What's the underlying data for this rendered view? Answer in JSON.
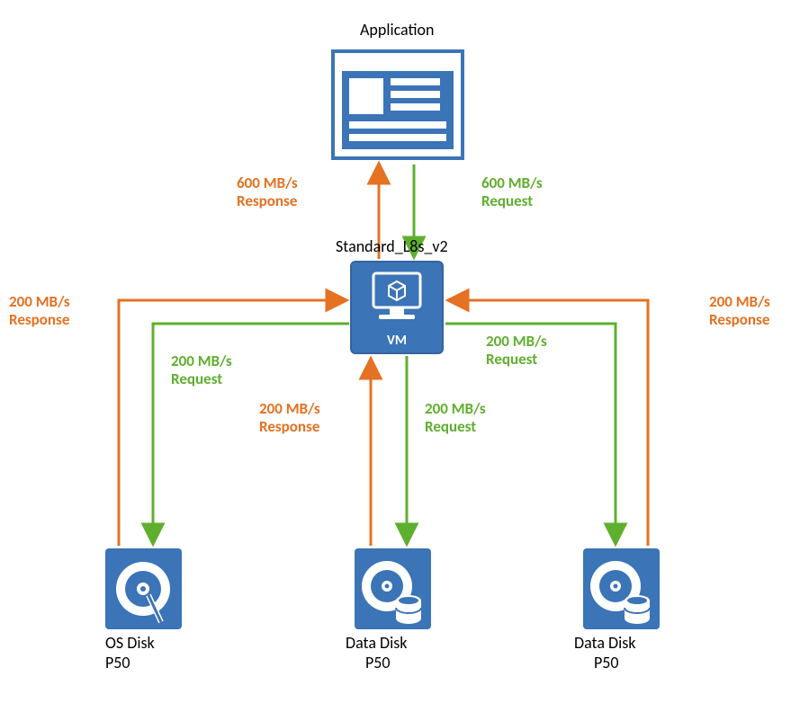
{
  "colors": {
    "blue": "#3B74B7",
    "green": "#5FAF2F",
    "orange": "#E57123"
  },
  "nodes": {
    "application": {
      "title": "Application"
    },
    "vm": {
      "title": "Standard_L8s_v2",
      "caption": "VM"
    },
    "os_disk": {
      "line1": "OS Disk",
      "line2": "P50"
    },
    "data_disk_1": {
      "line1": "Data Disk",
      "line2": "P50"
    },
    "data_disk_2": {
      "line1": "Data Disk",
      "line2": "P50"
    }
  },
  "labels": {
    "app_response": "600 MB/s\nResponse",
    "app_request": "600 MB/s\nRequest",
    "os_left_response_side": "200 MB/s\nResponse",
    "os_request": "200 MB/s\nRequest",
    "dd1_response": "200 MB/s\nResponse",
    "dd1_request": "200 MB/s\nRequest",
    "dd2_response_side": "200 MB/s\nResponse",
    "dd2_request": "200 MB/s\nRequest"
  }
}
